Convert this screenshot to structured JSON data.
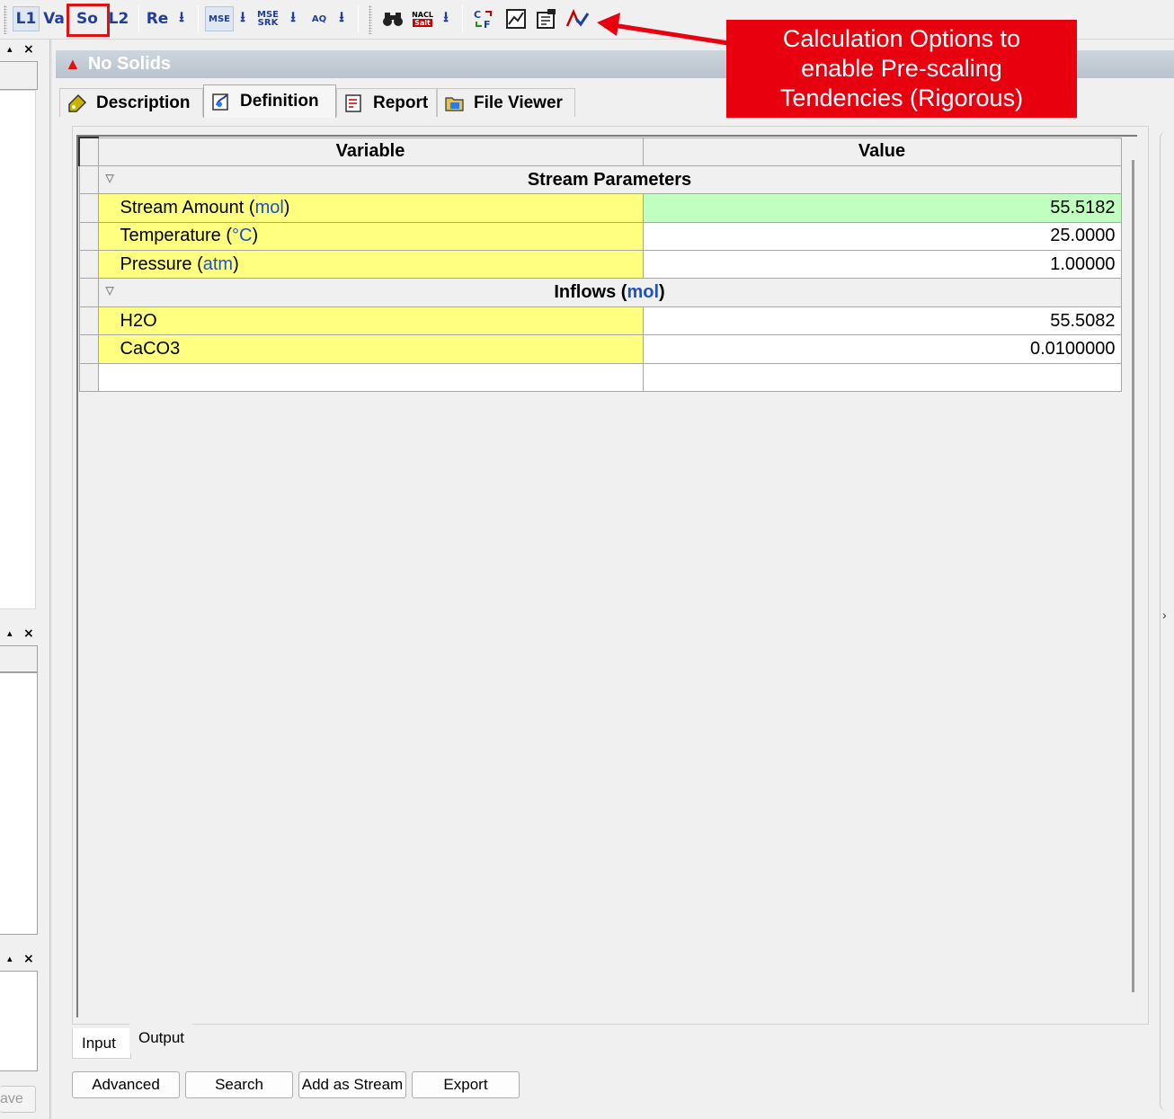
{
  "toolbar": {
    "buttons": [
      "L1",
      "Va",
      "So",
      "L2",
      "Re",
      "MSE",
      "MSE",
      "SRK",
      "AQ"
    ],
    "salt_top": "NACL",
    "salt_bottom": "Salt"
  },
  "left_dock": {
    "collapse_glyph": "▴",
    "close_glyph": "×",
    "save_fragment": "ave"
  },
  "panel": {
    "title": "No Solids",
    "tabs": [
      "Description",
      "Definition",
      "Report",
      "File Viewer"
    ]
  },
  "grid": {
    "header_variable": "Variable",
    "header_value": "Value",
    "section_stream": "Stream Parameters",
    "section_inflows": "Inflows",
    "section_inflows_unit": "mol",
    "rows_stream": [
      {
        "name": "Stream Amount",
        "unit": "mol",
        "value": "55.5182"
      },
      {
        "name": "Temperature",
        "unit": "°C",
        "value": "25.0000"
      },
      {
        "name": "Pressure",
        "unit": "atm",
        "value": "1.00000"
      }
    ],
    "rows_inflows": [
      {
        "name": "H2O",
        "value": "55.5082"
      },
      {
        "name": "CaCO3",
        "value": "0.0100000"
      }
    ]
  },
  "bottom_tabs": [
    "Input",
    "Output"
  ],
  "buttons": [
    "Advanced",
    "Search",
    "Add as Stream",
    "Export"
  ],
  "callout": {
    "line1": "Calculation Options to",
    "line2": "enable Pre-scaling",
    "line3": "Tendencies (Rigorous)"
  },
  "colors": {
    "callout_red": "#e8000e",
    "variable_yellow": "#ffff80",
    "value_green": "#c0ffc0",
    "unit_blue": "#1e50c8"
  }
}
